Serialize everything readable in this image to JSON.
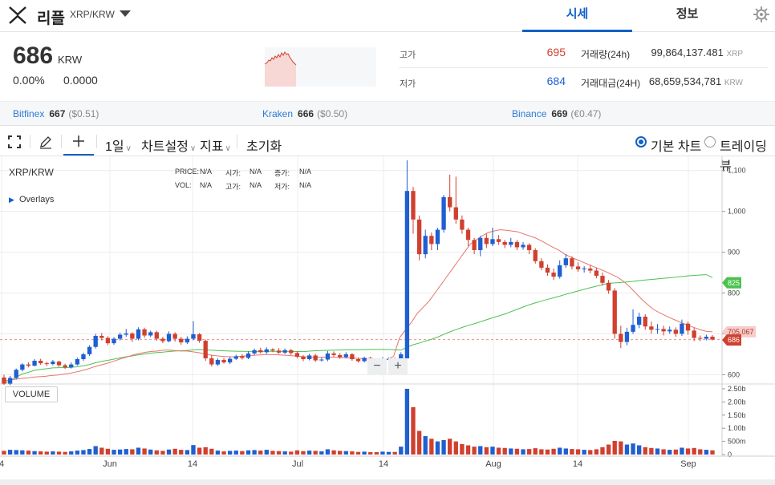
{
  "header": {
    "coin_name": "리플",
    "pair": "XRP/KRW",
    "tabs": [
      "시세",
      "정보"
    ]
  },
  "price": {
    "current": "686",
    "unit": "KRW",
    "change_rate": "0.00%",
    "change_amount": "0.0000"
  },
  "stats": {
    "high_label": "고가",
    "high_value": "695",
    "low_label": "저가",
    "low_value": "684",
    "volume_label": "거래량(24h)",
    "volume_value": "99,864,137.481",
    "volume_unit": "XRP",
    "amount_label": "거래대금(24H)",
    "amount_value": "68,659,534,781",
    "amount_unit": "KRW"
  },
  "exchanges": [
    {
      "name": "Bitfinex",
      "price": "667",
      "alt": "($0.51)"
    },
    {
      "name": "Kraken",
      "price": "666",
      "alt": "($0.50)"
    },
    {
      "name": "Binance",
      "price": "669",
      "alt": "(€0.47)"
    }
  ],
  "toolbar": {
    "interval": "1일",
    "chart_settings": "차트설정",
    "indicators": "지표",
    "reset": "초기화",
    "basic_chart": "기본 차트",
    "tradingview": "트레이딩뷰"
  },
  "chart_info": {
    "pair": "XRP/KRW",
    "overlays": "Overlays",
    "price_label": "PRICE:",
    "vol_label": "VOL:",
    "open_label": "시가:",
    "high_label": "고가:",
    "low_label": "저가:",
    "change_label": "증가:",
    "na": "N/A",
    "volume_button": "VOLUME",
    "zoom_out": "−",
    "zoom_in": "+"
  },
  "colors": {
    "up": "#1f5fd1",
    "down": "#d0402f",
    "accent": "#1261c4",
    "ma_short": "#e8746a",
    "ma_long": "#4cc24f"
  },
  "chart_data": {
    "type": "candlestick",
    "y_ticks": [
      600,
      700,
      800,
      900,
      1000,
      1100
    ],
    "y_tick_labels": [
      "600",
      "700",
      "800",
      "900",
      "1,000",
      "1,100"
    ],
    "ylim": [
      585,
      1125
    ],
    "x_ticks": [
      "4",
      "Jun",
      "14",
      "Jul",
      "14",
      "Aug",
      "14",
      "Sep"
    ],
    "volume_ticks": [
      "2.50b",
      "2.00b",
      "1.50b",
      "1.00b",
      "500m",
      "0"
    ],
    "volume_max": 2500,
    "ma_short_label": "705.067",
    "ma_long_label": "825",
    "current_label": "686",
    "current_value": 686,
    "candles": [
      [
        593,
        578,
        600,
        575,
        140
      ],
      [
        578,
        592,
        597,
        574,
        180
      ],
      [
        592,
        612,
        615,
        588,
        170
      ],
      [
        612,
        625,
        628,
        608,
        160
      ],
      [
        625,
        622,
        630,
        618,
        150
      ],
      [
        622,
        634,
        638,
        620,
        130
      ],
      [
        634,
        628,
        639,
        624,
        120
      ],
      [
        628,
        626,
        632,
        621,
        110
      ],
      [
        626,
        632,
        636,
        623,
        120
      ],
      [
        632,
        623,
        634,
        619,
        110
      ],
      [
        623,
        618,
        627,
        614,
        100
      ],
      [
        618,
        625,
        630,
        615,
        120
      ],
      [
        625,
        638,
        642,
        622,
        150
      ],
      [
        638,
        650,
        654,
        634,
        170
      ],
      [
        650,
        668,
        672,
        646,
        210
      ],
      [
        668,
        695,
        700,
        664,
        320
      ],
      [
        695,
        690,
        702,
        684,
        260
      ],
      [
        690,
        677,
        694,
        672,
        220
      ],
      [
        677,
        688,
        692,
        673,
        180
      ],
      [
        688,
        698,
        703,
        684,
        190
      ],
      [
        698,
        701,
        712,
        693,
        210
      ],
      [
        701,
        688,
        704,
        680,
        200
      ],
      [
        688,
        711,
        716,
        684,
        260
      ],
      [
        711,
        696,
        715,
        690,
        230
      ],
      [
        696,
        704,
        708,
        692,
        190
      ],
      [
        704,
        688,
        708,
        683,
        160
      ],
      [
        688,
        682,
        693,
        677,
        140
      ],
      [
        682,
        700,
        706,
        679,
        190
      ],
      [
        700,
        688,
        704,
        681,
        220
      ],
      [
        688,
        679,
        693,
        673,
        180
      ],
      [
        679,
        688,
        694,
        675,
        170
      ],
      [
        688,
        699,
        731,
        684,
        360
      ],
      [
        699,
        683,
        702,
        678,
        260
      ],
      [
        683,
        640,
        686,
        634,
        280
      ],
      [
        640,
        625,
        648,
        620,
        220
      ],
      [
        625,
        636,
        640,
        621,
        150
      ],
      [
        636,
        630,
        641,
        627,
        120
      ],
      [
        630,
        639,
        643,
        626,
        140
      ],
      [
        639,
        645,
        649,
        636,
        150
      ],
      [
        645,
        641,
        650,
        637,
        130
      ],
      [
        641,
        652,
        657,
        638,
        160
      ],
      [
        652,
        660,
        664,
        648,
        170
      ],
      [
        660,
        655,
        666,
        652,
        150
      ],
      [
        655,
        662,
        667,
        651,
        180
      ],
      [
        662,
        659,
        665,
        655,
        140
      ],
      [
        659,
        654,
        665,
        651,
        130
      ],
      [
        654,
        660,
        664,
        650,
        120
      ],
      [
        660,
        653,
        663,
        648,
        110
      ],
      [
        653,
        644,
        657,
        640,
        160
      ],
      [
        644,
        638,
        648,
        633,
        130
      ],
      [
        638,
        647,
        651,
        635,
        150
      ],
      [
        647,
        635,
        651,
        631,
        140
      ],
      [
        635,
        637,
        642,
        632,
        120
      ],
      [
        637,
        652,
        658,
        633,
        200
      ],
      [
        652,
        648,
        657,
        644,
        160
      ],
      [
        648,
        643,
        653,
        639,
        140
      ],
      [
        643,
        650,
        655,
        640,
        130
      ],
      [
        650,
        638,
        653,
        634,
        120
      ],
      [
        638,
        633,
        642,
        630,
        100
      ],
      [
        633,
        641,
        644,
        630,
        110
      ],
      [
        641,
        635,
        644,
        632,
        90
      ],
      [
        635,
        632,
        640,
        629,
        90
      ],
      [
        632,
        637,
        643,
        630,
        110
      ],
      [
        637,
        639,
        642,
        631,
        100
      ],
      [
        639,
        632,
        642,
        628,
        100
      ],
      [
        632,
        650,
        655,
        630,
        300
      ],
      [
        640,
        1050,
        1125,
        635,
        2500
      ],
      [
        1050,
        980,
        1060,
        945,
        1800
      ],
      [
        980,
        895,
        990,
        880,
        900
      ],
      [
        895,
        940,
        955,
        885,
        700
      ],
      [
        940,
        920,
        948,
        905,
        600
      ],
      [
        920,
        955,
        960,
        905,
        500
      ],
      [
        955,
        1035,
        1040,
        948,
        550
      ],
      [
        1035,
        1010,
        1090,
        1000,
        600
      ],
      [
        1010,
        980,
        1085,
        970,
        500
      ],
      [
        980,
        955,
        990,
        945,
        400
      ],
      [
        955,
        930,
        960,
        915,
        350
      ],
      [
        930,
        905,
        935,
        895,
        300
      ],
      [
        905,
        935,
        940,
        890,
        320
      ],
      [
        935,
        920,
        945,
        910,
        280
      ],
      [
        920,
        932,
        960,
        915,
        300
      ],
      [
        932,
        925,
        942,
        918,
        260
      ],
      [
        925,
        918,
        930,
        910,
        250
      ],
      [
        918,
        925,
        935,
        912,
        230
      ],
      [
        925,
        912,
        930,
        905,
        220
      ],
      [
        912,
        918,
        925,
        906,
        200
      ],
      [
        918,
        905,
        922,
        895,
        210
      ],
      [
        905,
        878,
        910,
        872,
        240
      ],
      [
        878,
        862,
        885,
        856,
        200
      ],
      [
        862,
        850,
        870,
        842,
        190
      ],
      [
        850,
        840,
        860,
        832,
        220
      ],
      [
        840,
        868,
        880,
        835,
        260
      ],
      [
        868,
        885,
        895,
        862,
        230
      ],
      [
        885,
        865,
        890,
        858,
        210
      ],
      [
        865,
        858,
        875,
        852,
        200
      ],
      [
        858,
        860,
        866,
        850,
        180
      ],
      [
        860,
        855,
        868,
        848,
        170
      ],
      [
        855,
        842,
        862,
        836,
        200
      ],
      [
        842,
        825,
        850,
        818,
        280
      ],
      [
        825,
        806,
        832,
        798,
        380
      ],
      [
        806,
        700,
        812,
        688,
        520
      ],
      [
        700,
        680,
        720,
        665,
        500
      ],
      [
        680,
        705,
        715,
        672,
        380
      ],
      [
        705,
        722,
        760,
        700,
        420
      ],
      [
        722,
        742,
        752,
        714,
        350
      ],
      [
        742,
        718,
        748,
        710,
        280
      ],
      [
        718,
        710,
        730,
        700,
        250
      ],
      [
        710,
        712,
        724,
        700,
        230
      ],
      [
        712,
        706,
        720,
        696,
        200
      ],
      [
        706,
        710,
        718,
        700,
        180
      ],
      [
        710,
        700,
        716,
        693,
        190
      ],
      [
        700,
        725,
        735,
        695,
        260
      ],
      [
        725,
        708,
        730,
        698,
        230
      ],
      [
        708,
        690,
        715,
        682,
        250
      ],
      [
        690,
        688,
        696,
        682,
        200
      ],
      [
        688,
        693,
        698,
        684,
        180
      ],
      [
        693,
        686,
        697,
        684,
        160
      ]
    ],
    "ma_short": [
      585,
      587,
      589,
      591,
      592,
      594,
      595,
      596,
      598,
      599,
      601,
      603,
      606,
      609,
      613,
      618,
      622,
      626,
      630,
      635,
      640,
      644,
      649,
      652,
      655,
      657,
      658,
      660,
      660,
      659,
      658,
      658,
      656,
      654,
      651,
      648,
      646,
      645,
      644,
      644,
      645,
      646,
      647,
      648,
      649,
      649,
      649,
      648,
      647,
      646,
      645,
      644,
      643,
      643,
      643,
      643,
      643,
      642,
      641,
      641,
      640,
      639,
      638,
      638,
      637,
      637,
      645,
      690,
      710,
      728,
      750,
      765,
      780,
      800,
      820,
      840,
      860,
      880,
      900,
      920,
      930,
      940,
      948,
      952,
      955,
      954,
      952,
      950,
      945,
      940,
      935,
      928,
      920,
      912,
      905,
      895,
      888,
      882,
      876,
      870,
      864,
      858,
      852,
      845,
      838,
      828,
      815,
      800,
      785,
      772,
      760,
      752,
      745,
      738,
      732,
      726,
      720,
      715,
      710,
      706,
      705
    ]
  }
}
